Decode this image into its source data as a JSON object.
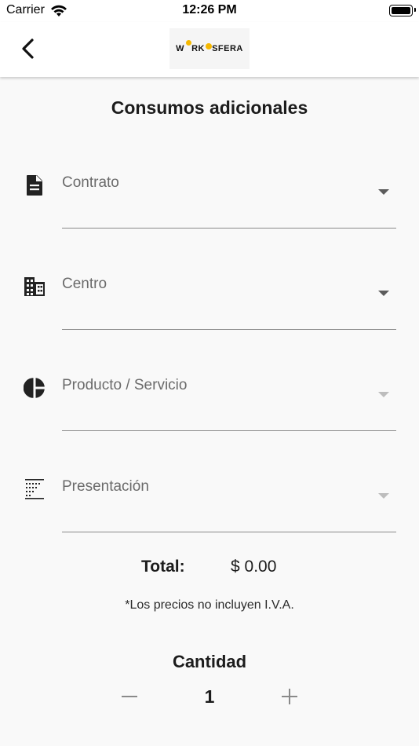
{
  "status_bar": {
    "carrier": "Carrier",
    "time": "12:26 PM"
  },
  "nav": {
    "back_icon": "chevron-left-icon",
    "logo_text": "WORKOSFERA",
    "logo_accent": "#f5b800"
  },
  "page": {
    "title": "Consumos adicionales"
  },
  "form": {
    "fields": [
      {
        "label": "Contrato",
        "icon": "document-icon",
        "enabled": true
      },
      {
        "label": "Centro",
        "icon": "building-icon",
        "enabled": true
      },
      {
        "label": "Producto / Servicio",
        "icon": "pie-chart-icon",
        "enabled": false
      },
      {
        "label": "Presentación",
        "icon": "list-grid-icon",
        "enabled": false
      }
    ]
  },
  "summary": {
    "total_label": "Total:",
    "total_value": "$ 0.00",
    "note": "*Los precios no incluyen I.V.A."
  },
  "quantity": {
    "title": "Cantidad",
    "value": "1"
  }
}
